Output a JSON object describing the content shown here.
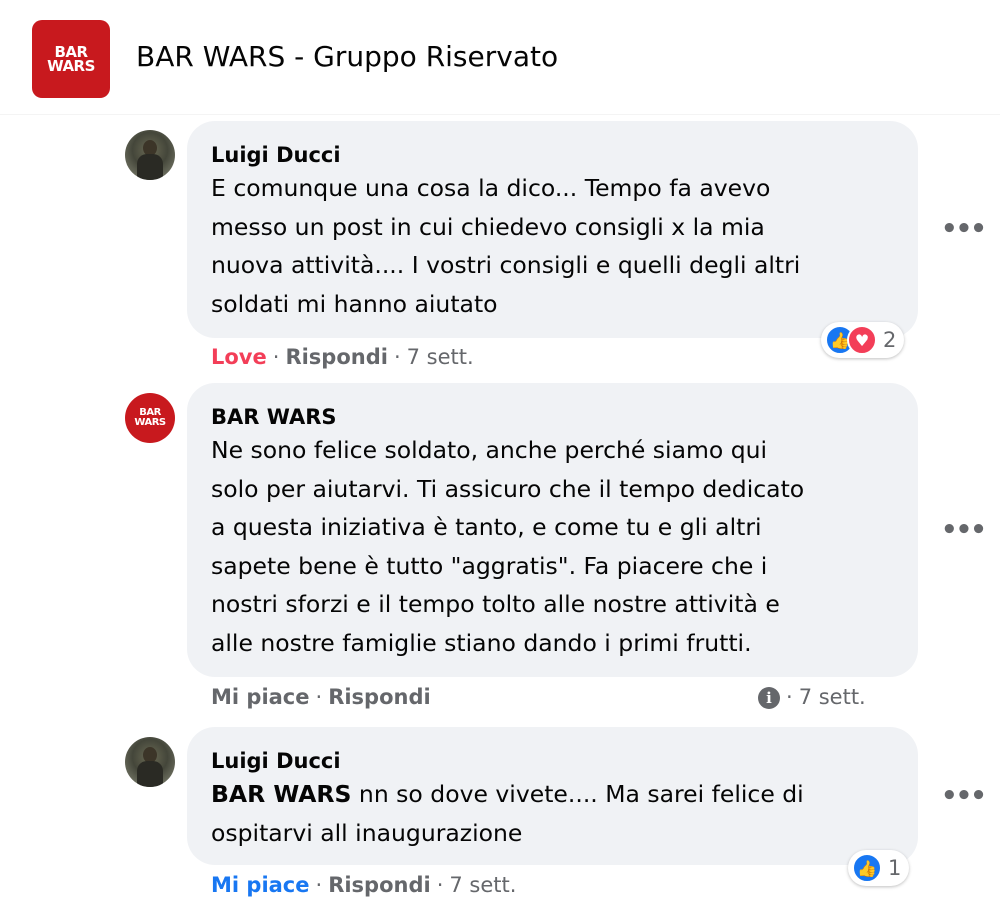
{
  "group": {
    "logo_line1": "BAR",
    "logo_line2": "WARS",
    "title": "BAR WARS - Gruppo Riservato"
  },
  "comments": [
    {
      "author": "Luigi Ducci",
      "text": "E comunque una cosa la dico... Tempo fa avevo\nmesso un post in cui chiedevo consigli x la mia\nnuova attività.... I vostri consigli e quelli degli altri\nsoldati mi hanno aiutato",
      "action_react": "Love",
      "action_reply": "Rispondi",
      "time": "7 sett.",
      "reaction_count": "2",
      "reaction_icons": [
        "like-icon",
        "heart-icon"
      ]
    },
    {
      "author": "BAR WARS",
      "text": "Ne sono felice soldato, anche perché siamo qui\nsolo per aiutarvi. Ti assicuro che il tempo dedicato\na questa iniziativa è tanto, e come tu e gli altri\nsapete bene è tutto \"aggratis\". Fa piacere che i\nnostri sforzi e il tempo tolto alle nostre attività e\nalle nostre famiglie stiano dando i primi frutti.",
      "action_react": "Mi piace",
      "action_reply": "Rispondi",
      "time": "7 sett.",
      "info_icon": "i"
    },
    {
      "author": "Luigi Ducci",
      "mention": "BAR WARS",
      "text": " nn so dove vivete.... Ma sarei felice di\nospitarvi all inaugurazione",
      "action_react": "Mi piace",
      "action_reply": "Rispondi",
      "time": "7 sett.",
      "reaction_count": "1",
      "reaction_icons": [
        "like-icon"
      ]
    }
  ],
  "more_label": "•••",
  "separator": "·",
  "colors": {
    "brand_red": "#c8191e",
    "bubble_bg": "#f0f2f5",
    "love": "#f33e58",
    "like_blue": "#1877f2",
    "secondary_text": "#65676b"
  }
}
